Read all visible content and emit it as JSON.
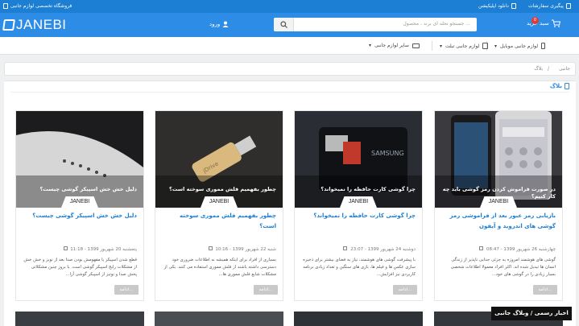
{
  "topbar": {
    "store_title": "فروشگاه تخصصی لوازم جانبی",
    "download_app": "دانلود اپلیکیشن",
    "order_tracking": "پیگیری سفارشات"
  },
  "header": {
    "logo_text": "JANEBI",
    "login_label": "ورود",
    "search_placeholder": "جستجو نحله ای برند ، محصول ...",
    "cart_label": "سبد خرید",
    "cart_count": "0"
  },
  "nav": {
    "items": [
      {
        "label": "لوازم جانبی موبایل",
        "icon": "mobile-icon"
      },
      {
        "label": "لوازم جانبی تبلت",
        "icon": "tablet-icon"
      },
      {
        "label": "سایر لوازم جانبی",
        "icon": "devices-icon"
      }
    ]
  },
  "breadcrumb": {
    "home": "جانبی",
    "sep": "/",
    "current": "بلاگ"
  },
  "section": {
    "title": "بلاگ"
  },
  "cards": [
    {
      "caption": "در صورت فراموش کردن رمز گوشی باید چه کار کنیم؟",
      "brand": "JANEBI",
      "title": "بازیابی رمز عبور بعد از فراموشی رمز گوشی های اندروید و آیفون",
      "meta": "چهارشنبه 26 شهریور 1399 - 08:47",
      "excerpt": "گوشی های هوشمند امروزه به جزئی جدایی ناپذیر از زندگی انسان ها تبدیل شده اند. اکثر افراد معمولا اطلاعات شخصی بسیار زیادی را در گوشی های خود...",
      "more": "ادامه..."
    },
    {
      "caption": "چرا گوشی کارت حافظه را نمیخواند؟",
      "brand": "JANEBI",
      "title": "چرا گوشی کارت حافظه را نمیخواند؟",
      "meta": "دوشنبه 24 شهریور 1399 - 23:07",
      "excerpt": "با پیشرفت گوشی های هوشمند، نیاز به فضای بیشتر برای ذخیره سازی عکس ها و فیلم ها، بازی های سنگین و تعداد زیادی برنامه کاربردی نیز افزایش...",
      "more": "ادامه..."
    },
    {
      "caption": "چطور بفهمیم فلش مموری سوخته است؟",
      "brand": "JANEBI",
      "title": "چطور بفهمیم فلش مموری سوخته است؟",
      "meta": "شنبه 22 شهریور 1399 - 10:16",
      "excerpt": "بسیاری از افراد برای اینکه همیشه به اطلاعات ضروری خود دسترسی داشته باشند از فلش مموری استفاده می کنند. یکی از مشکلات شایع فلش مموری ها...",
      "more": "ادامه..."
    },
    {
      "caption": "دلیل خش خش اسپیکر گوشی چیست؟",
      "brand": "JANEBI",
      "title": "دلیل خش خش اسپیکر گوشی چیست؟",
      "meta": "پنجشنبه 20 شهریور 1399 - 11:18",
      "excerpt": "قطع شدن اسپیکر یا مفهومش بودن صدا بعد از نویز و خش خش از مشکلات رایج اسپیکر گوشی است. با بروز چنین مشکلاتی پخش صدا و نوتیز از اسپیکر گوشی آزا...",
      "more": "ادامه..."
    }
  ],
  "watermark": "اخبار رسمی / وبلاگ جانبی"
}
